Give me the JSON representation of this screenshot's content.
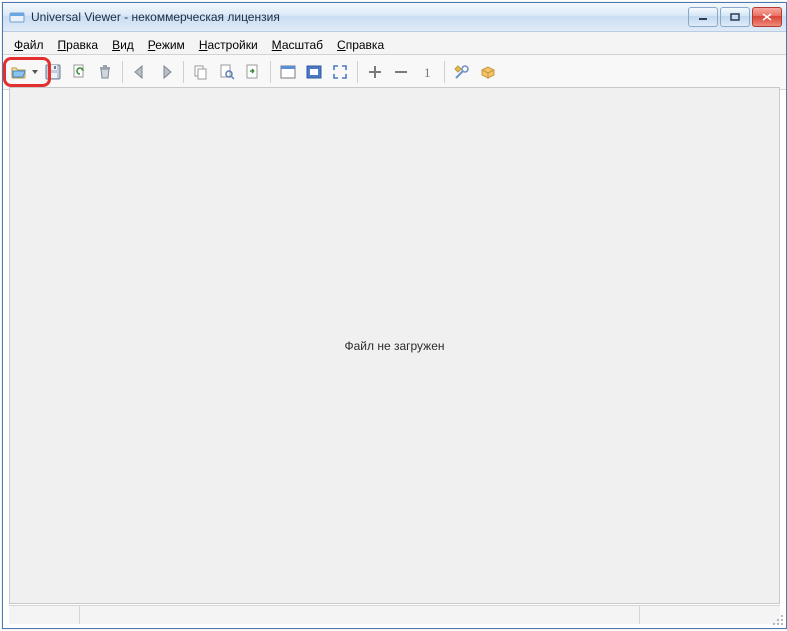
{
  "title": "Universal Viewer - некоммерческая лицензия",
  "menu": {
    "file": {
      "label": "Файл",
      "underline_index": 0
    },
    "edit": {
      "label": "Правка",
      "underline_index": 0
    },
    "view": {
      "label": "Вид",
      "underline_index": 0
    },
    "mode": {
      "label": "Режим",
      "underline_index": 0
    },
    "settings": {
      "label": "Настройки",
      "underline_index": 0
    },
    "zoom": {
      "label": "Масштаб",
      "underline_index": 0
    },
    "help": {
      "label": "Справка",
      "underline_index": 0
    }
  },
  "toolbar": {
    "open": "open",
    "save": "save",
    "reload": "reload",
    "delete": "delete",
    "back": "back",
    "forward": "forward",
    "copy": "copy",
    "find": "find",
    "goto": "goto",
    "fit_window": "fit_window",
    "fit_width": "fit_width",
    "fullscreen": "fullscreen",
    "zoom_in": "+",
    "zoom_out": "−",
    "zoom_100": "1",
    "options": "options",
    "plugins": "plugins"
  },
  "content": {
    "message": "Файл не загружен"
  },
  "colors": {
    "accent_highlight": "#e2302e",
    "titlebar_top": "#f4f8fc",
    "titlebar_bottom": "#dfeaf6"
  }
}
